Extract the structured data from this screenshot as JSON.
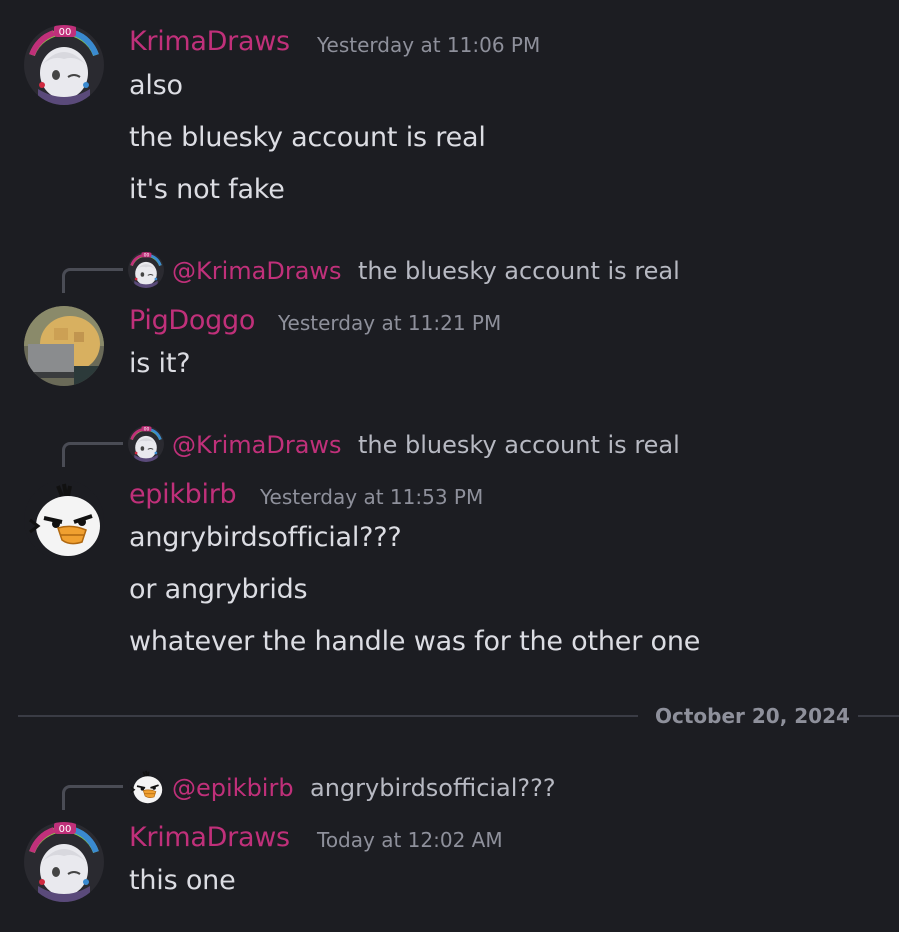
{
  "messages": [
    {
      "author": "KrimaDraws",
      "timestamp": "Yesterday at 11:06 PM",
      "lines": [
        "also",
        "the bluesky account is real",
        "it's not fake"
      ]
    },
    {
      "reply_to": {
        "author": "@KrimaDraws",
        "text": "the bluesky account is real"
      },
      "author": "PigDoggo",
      "timestamp": "Yesterday at 11:21 PM",
      "lines": [
        "is it?"
      ]
    },
    {
      "reply_to": {
        "author": "@KrimaDraws",
        "text": "the bluesky account is real"
      },
      "author": "epikbirb",
      "timestamp": "Yesterday at 11:53 PM",
      "lines": [
        "angrybirdsofficial???",
        "or angrybrids",
        "whatever the handle was for the other one"
      ]
    },
    {
      "reply_to": {
        "author": "@epikbirb",
        "text": "angrybirdsofficial???"
      },
      "author": "KrimaDraws",
      "timestamp": "Today at 12:02 AM",
      "lines": [
        "this one"
      ]
    }
  ],
  "date_divider": "October 20, 2024",
  "colors": {
    "background": "#1c1d22",
    "username": "#c0307a",
    "timestamp": "#8e909b",
    "text": "#dcdde3"
  },
  "icons": {
    "krima_avatar": "anime-avatar-icon",
    "pigdoggo_avatar": "blurred-photo-avatar-icon",
    "epikbirb_avatar": "white-bird-avatar-icon"
  }
}
